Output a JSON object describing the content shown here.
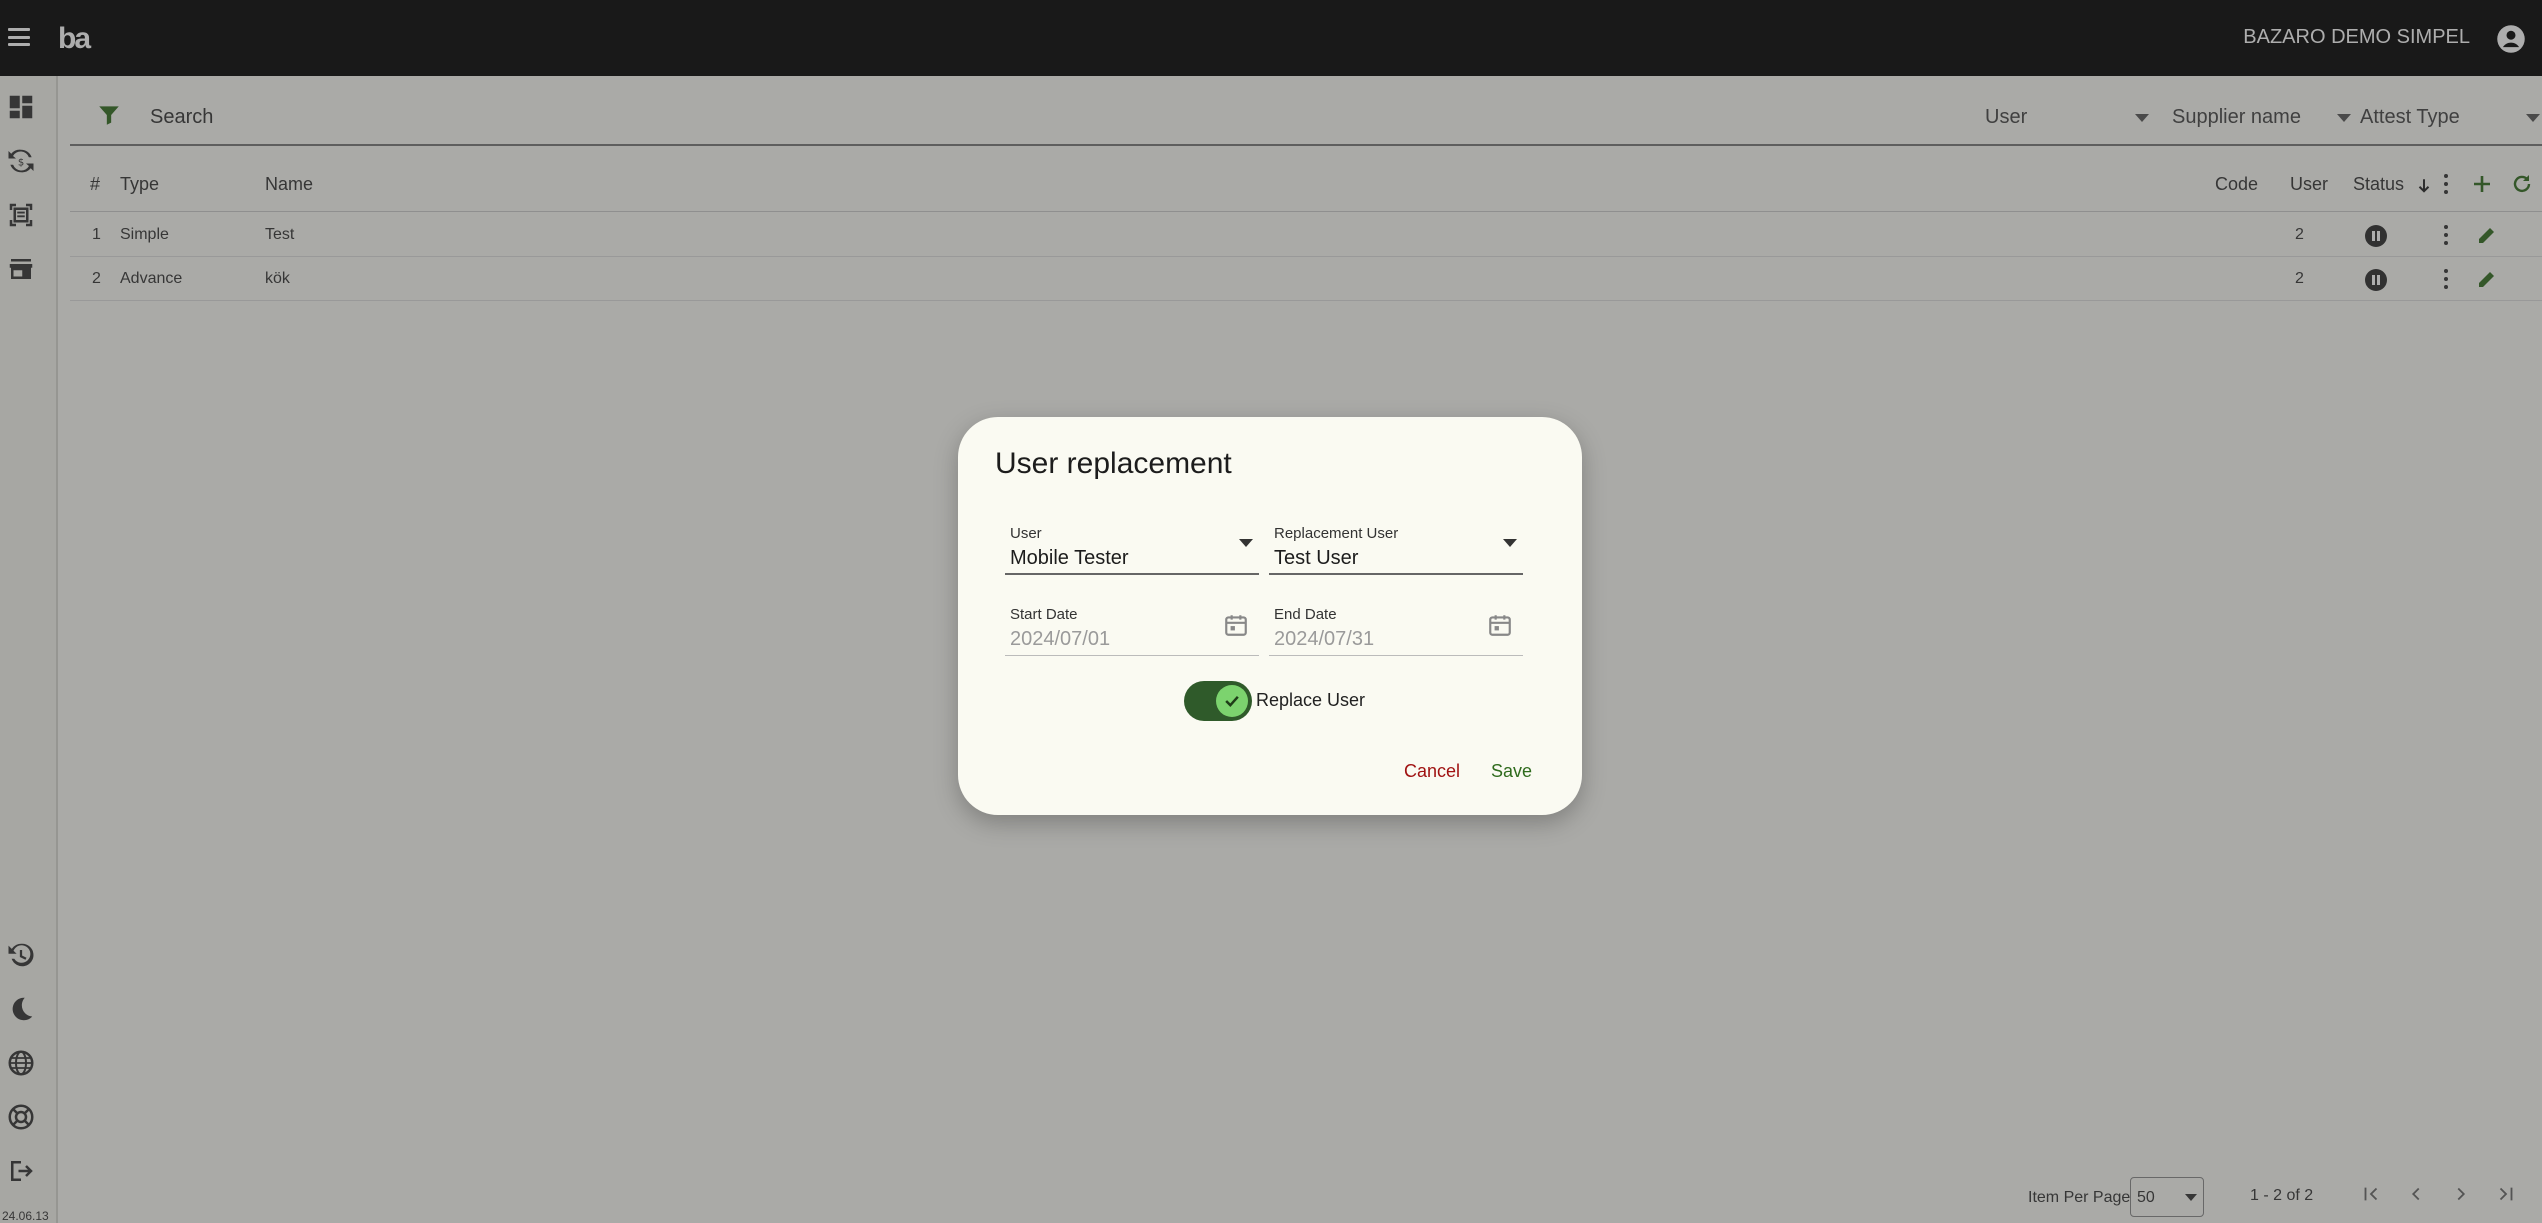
{
  "app": {
    "logo": "ba",
    "company": "BAZARO DEMO SIMPEL",
    "version": "24.06.13"
  },
  "search": {
    "label": "Search"
  },
  "filters": [
    {
      "label": "User"
    },
    {
      "label": "Supplier name"
    },
    {
      "label": "Attest Type"
    }
  ],
  "table": {
    "columns": {
      "num": "#",
      "type": "Type",
      "name": "Name",
      "code": "Code",
      "user": "User",
      "status": "Status"
    },
    "rows": [
      {
        "num": "1",
        "type": "Simple",
        "name": "Test",
        "code": "",
        "user": "2"
      },
      {
        "num": "2",
        "type": "Advance",
        "name": "kök",
        "code": "",
        "user": "2"
      }
    ]
  },
  "footer": {
    "items_per_page_label": "Item Per Page",
    "items_per_page_value": "50",
    "range": "1 - 2 of 2"
  },
  "dialog": {
    "title": "User replacement",
    "user_label": "User",
    "user_value": "Mobile Tester",
    "replacement_label": "Replacement User",
    "replacement_value": "Test User",
    "start_label": "Start Date",
    "start_value": "2024/07/01",
    "end_label": "End Date",
    "end_value": "2024/07/31",
    "toggle_label": "Replace User",
    "toggle_on": true,
    "cancel_label": "Cancel",
    "save_label": "Save"
  },
  "colors": {
    "accent": "#2f6b1d",
    "danger": "#a01212",
    "toggle_track": "#2f5a2a",
    "toggle_knob": "#7cd36e"
  }
}
